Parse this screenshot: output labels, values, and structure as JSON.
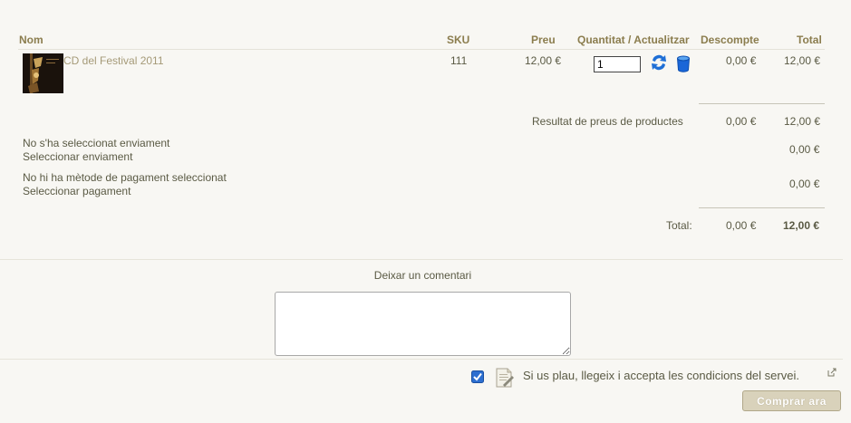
{
  "table": {
    "headers": {
      "name": "Nom",
      "sku": "SKU",
      "price": "Preu",
      "quantity": "Quantitat / Actualitzar",
      "discount": "Descompte",
      "total": "Total"
    },
    "rows": [
      {
        "name": "CD del Festival 2011",
        "sku": "111",
        "price": "12,00 €",
        "quantity": "1",
        "discount": "0,00 €",
        "total": "12,00 €"
      }
    ]
  },
  "summary": {
    "products_label": "Resultat de preus de productes",
    "products_discount": "0,00 €",
    "products_total": "12,00 €",
    "shipping_status": "No s'ha seleccionat enviament",
    "shipping_link": "Seleccionar enviament",
    "shipping_total": "0,00 €",
    "payment_status": "No hi ha mètode de pagament seleccionat",
    "payment_link": "Seleccionar pagament",
    "payment_total": "0,00 €",
    "total_label": "Total:",
    "total_discount": "0,00 €",
    "total_amount": "12,00 €"
  },
  "comment": {
    "label": "Deixar un comentari",
    "value": ""
  },
  "tos": {
    "label": "Si us plau, llegeix i accepta les condicions del servei.",
    "checked": true
  },
  "checkout_button": "Comprar ara",
  "colors": {
    "header_text": "#8b7d4e",
    "link": "#a59a78",
    "button_bg": "#d9d2bb",
    "update_icon": "#1f6fd6",
    "background": "#f8f7f3"
  }
}
